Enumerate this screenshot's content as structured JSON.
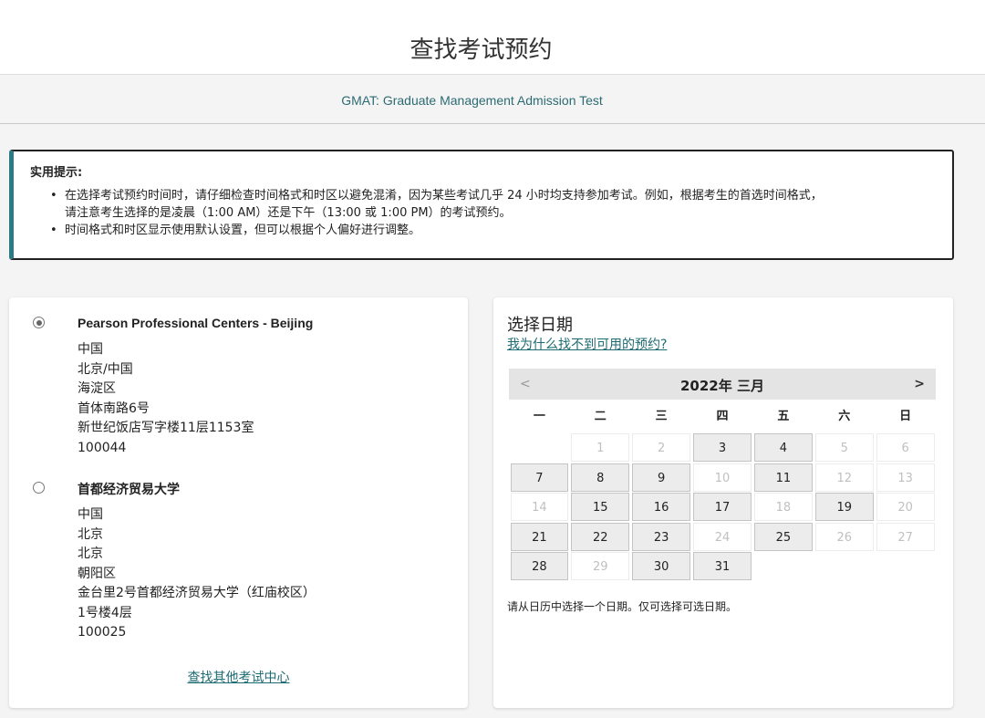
{
  "page_title": "查找考试预约",
  "exam_name": "GMAT: Graduate Management Admission Test",
  "tips": {
    "title": "实用提示:",
    "items": [
      "在选择考试预约时间时，请仔细检查时间格式和时区以避免混淆，因为某些考试几乎 24 小时均支持参加考试。例如，根据考生的首选时间格式，",
      "请注意考生选择的是凌晨（1:00 AM）还是下午（13:00 或 1:00 PM）的考试预约。",
      "时间格式和时区显示使用默认设置，但可以根据个人偏好进行调整。"
    ]
  },
  "locations": [
    {
      "name": "Pearson Professional Centers - Beijing",
      "selected": true,
      "address": [
        "中国",
        "北京/中国",
        "海淀区",
        "首体南路6号",
        "新世纪饭店写字楼11层1153室",
        "100044"
      ]
    },
    {
      "name": "首都经济贸易大学",
      "selected": false,
      "address": [
        "中国",
        "北京",
        "北京",
        "朝阳区",
        "金台里2号首都经济贸易大学（红庙校区）",
        "1号楼4层",
        "100025"
      ]
    }
  ],
  "find_other_link": "查找其他考试中心",
  "calendar": {
    "title": "选择日期",
    "why_link": "我为什么找不到可用的预约?",
    "prev": "<",
    "next": ">",
    "month_label": "2022年 三月",
    "weekdays": [
      "一",
      "二",
      "三",
      "四",
      "五",
      "六",
      "日"
    ],
    "weeks": [
      [
        null,
        {
          "d": "1",
          "a": false
        },
        {
          "d": "2",
          "a": false
        },
        {
          "d": "3",
          "a": true
        },
        {
          "d": "4",
          "a": true
        },
        {
          "d": "5",
          "a": false
        },
        {
          "d": "6",
          "a": false
        }
      ],
      [
        {
          "d": "7",
          "a": true
        },
        {
          "d": "8",
          "a": true
        },
        {
          "d": "9",
          "a": true
        },
        {
          "d": "10",
          "a": false
        },
        {
          "d": "11",
          "a": true
        },
        {
          "d": "12",
          "a": false
        },
        {
          "d": "13",
          "a": false
        }
      ],
      [
        {
          "d": "14",
          "a": false
        },
        {
          "d": "15",
          "a": true
        },
        {
          "d": "16",
          "a": true
        },
        {
          "d": "17",
          "a": true
        },
        {
          "d": "18",
          "a": false
        },
        {
          "d": "19",
          "a": true
        },
        {
          "d": "20",
          "a": false
        }
      ],
      [
        {
          "d": "21",
          "a": true
        },
        {
          "d": "22",
          "a": true
        },
        {
          "d": "23",
          "a": true
        },
        {
          "d": "24",
          "a": false
        },
        {
          "d": "25",
          "a": true
        },
        {
          "d": "26",
          "a": false
        },
        {
          "d": "27",
          "a": false
        }
      ],
      [
        {
          "d": "28",
          "a": true
        },
        {
          "d": "29",
          "a": false
        },
        {
          "d": "30",
          "a": true
        },
        {
          "d": "31",
          "a": true
        },
        null,
        null,
        null
      ]
    ],
    "note": "请从日历中选择一个日期。仅可选择可选日期。"
  },
  "colors": {
    "accent": "#2b7a86",
    "link": "#1d6b73",
    "available_bg": "#ececec"
  }
}
